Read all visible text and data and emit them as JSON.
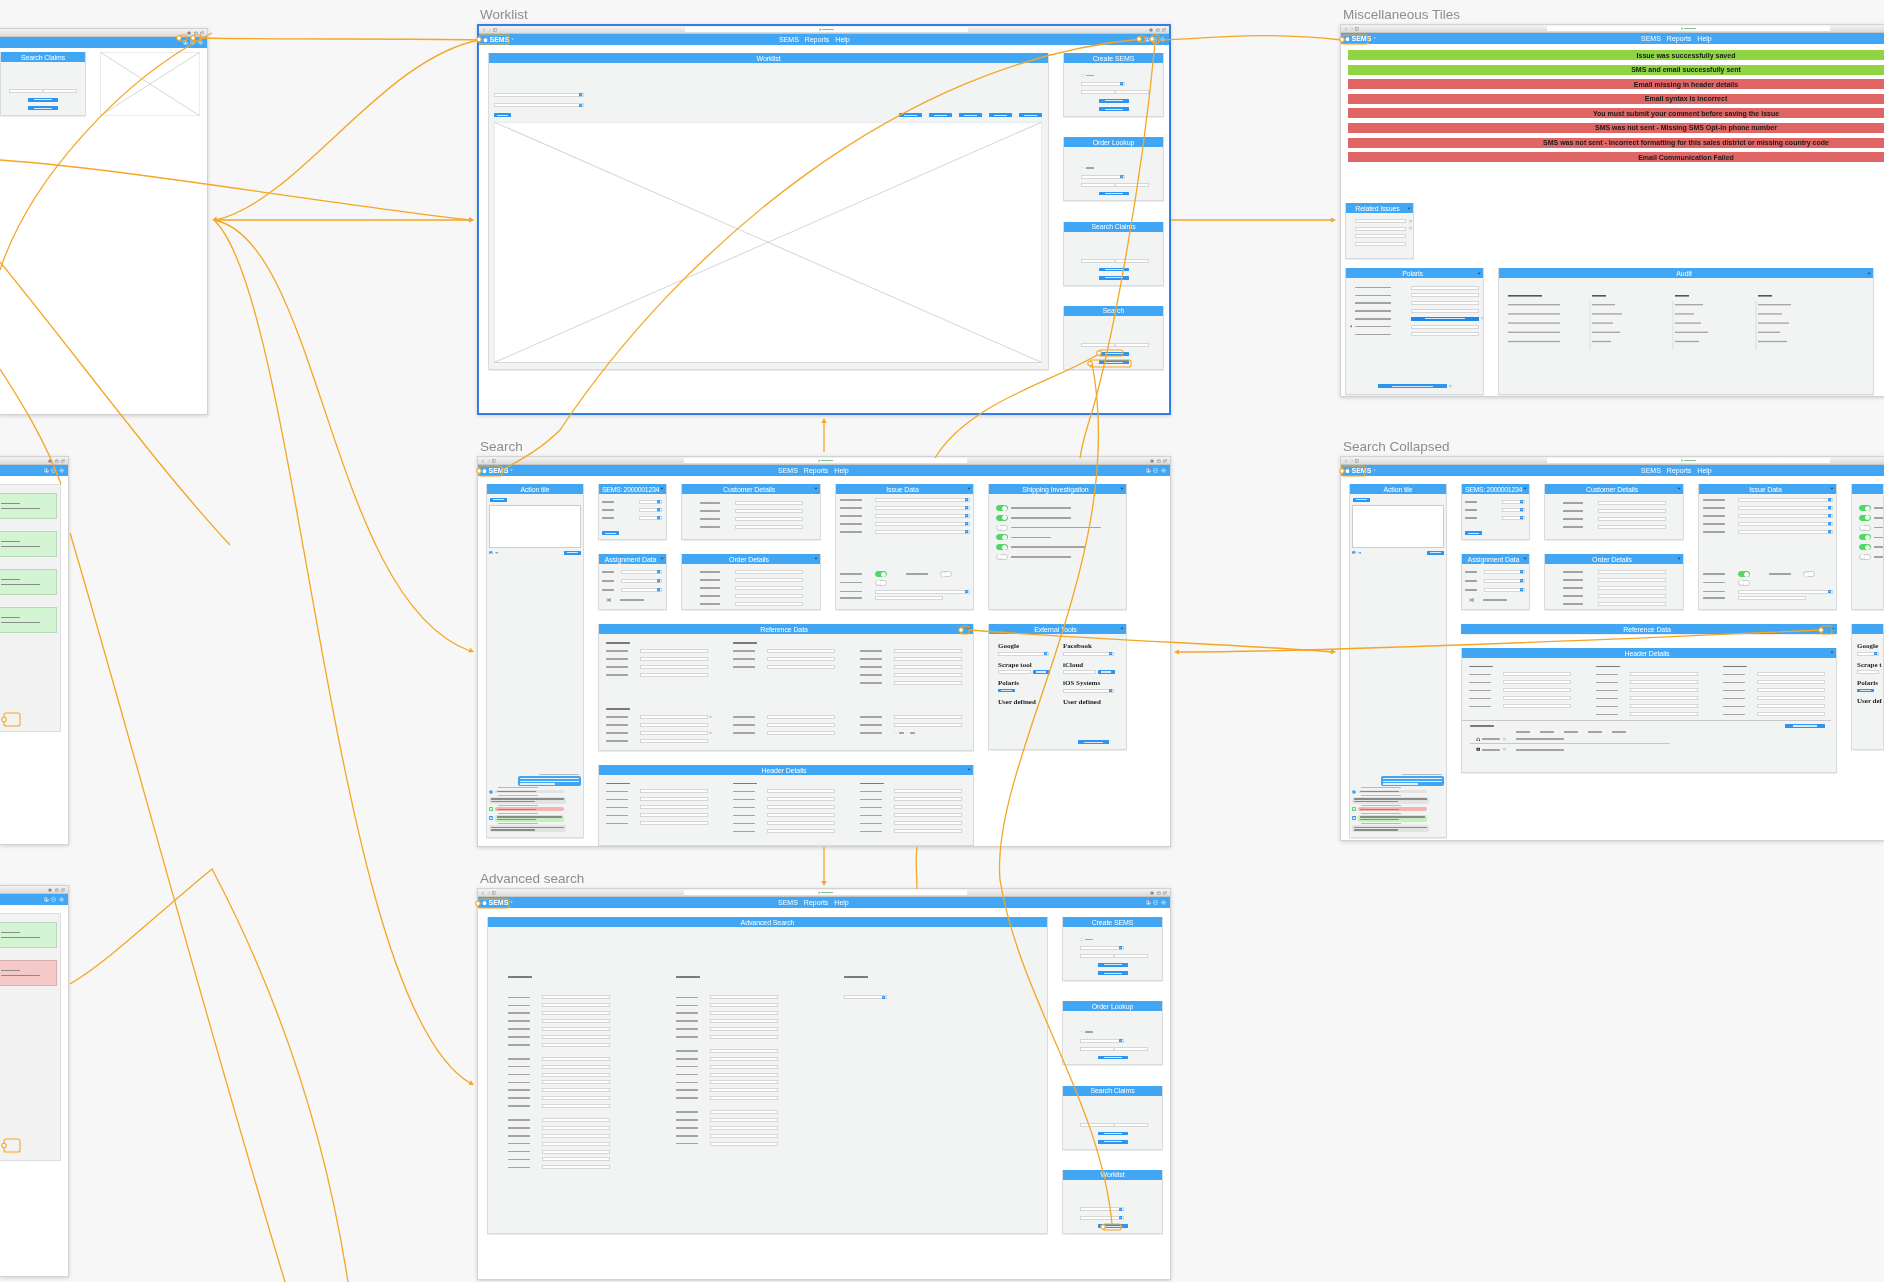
{
  "artboards": [
    {
      "kind": "claims",
      "selected": false,
      "tile": {
        "title": "Search Claims",
        "rows": [
          {
            "kind": "search"
          },
          {
            "kind": "button"
          },
          {
            "kind": "button"
          }
        ]
      }
    },
    {
      "kind": "worklist",
      "title": "Worklist",
      "selected": true,
      "nav": {
        "brand": "SEMS",
        "links": [
          "SEMS",
          "Reports",
          "Help"
        ]
      },
      "main": {
        "title": "Worklist",
        "filters": [
          {
            "kind": "select"
          },
          {
            "kind": "select"
          }
        ],
        "actions": [
          {
            "kind": "button"
          },
          {
            "kind": "button"
          },
          {
            "kind": "button"
          },
          {
            "kind": "button"
          },
          {
            "kind": "button"
          },
          {
            "kind": "button"
          }
        ]
      },
      "side": [
        {
          "title": "Create SEMS",
          "rows": [
            {
              "kind": "check",
              "checked": false
            },
            {
              "kind": "select"
            },
            {
              "kind": "search"
            },
            {
              "kind": "button"
            },
            {
              "kind": "button"
            }
          ]
        },
        {
          "title": "Order Lookup",
          "rows": [
            {
              "kind": "check",
              "checked": false
            },
            {
              "kind": "select"
            },
            {
              "kind": "search"
            },
            {
              "kind": "button"
            }
          ]
        },
        {
          "title": "Search Claims",
          "rows": [
            {
              "kind": "search"
            },
            {
              "kind": "button"
            },
            {
              "kind": "button"
            }
          ]
        },
        {
          "title": "Search",
          "rows": [
            {
              "kind": "search"
            },
            {
              "kind": "button"
            },
            {
              "kind": "button"
            }
          ]
        }
      ]
    },
    {
      "kind": "tiles",
      "title": "Miscellaneous Tiles",
      "selected": false,
      "nav": {
        "brand": "SEMS",
        "links": [
          "SEMS",
          "Reports",
          "Help"
        ]
      },
      "messages": [
        {
          "text": "Issue was successfully saved",
          "color": "#8ed443"
        },
        {
          "text": "SMS and email successfully sent",
          "color": "#8ed443"
        },
        {
          "text": "Email missing in header details",
          "color": "#e06666"
        },
        {
          "text": "Email syntax is incorrect",
          "color": "#e06666"
        },
        {
          "text": "You must submit your comment before saving the issue",
          "color": "#e06666"
        },
        {
          "text": "SMS was not sent - Missing SMS Opt-in phone number",
          "color": "#e06666"
        },
        {
          "text": "SMS was not sent - Incorrect formatting for this sales district or missing country code",
          "color": "#e06666"
        },
        {
          "text": "Email Communication Failed",
          "color": "#e06666"
        }
      ],
      "related": {
        "title": "Related issues",
        "expanded": true,
        "rows": [
          {
            "kind": "lookup"
          },
          {
            "kind": "lookup"
          },
          {
            "kind": "field"
          },
          {
            "kind": "field"
          }
        ]
      },
      "polaris": {
        "title": "Polaris",
        "expanded": true,
        "rows": [
          {
            "kind": "field",
            "alert": false
          },
          {
            "kind": "field",
            "alert": false
          },
          {
            "kind": "field",
            "alert": false
          },
          {
            "kind": "field",
            "alert": false
          },
          {
            "kind": "link",
            "alert": false
          },
          {
            "kind": "field",
            "alert": true
          },
          {
            "kind": "field",
            "alert": false
          }
        ]
      },
      "audit": {
        "title": "Audit",
        "expanded": true
      }
    },
    {
      "kind": "notifications",
      "selected": false,
      "cards": [
        {
          "color": "#d3f5d3"
        },
        {
          "color": "#d3f5d3"
        },
        {
          "color": "#d3f5d3"
        },
        {
          "color": "#d3f5d3"
        }
      ]
    },
    {
      "kind": "search",
      "title": "Search",
      "selected": false,
      "nav": {
        "brand": "SEMS",
        "links": [
          "SEMS",
          "Reports",
          "Help"
        ]
      },
      "action": {
        "title": "Action tile",
        "messages": [
          {
            "kind": "outgoing"
          },
          {
            "kind": "file"
          },
          {
            "kind": "note"
          },
          {
            "kind": "failed"
          },
          {
            "kind": "sent"
          },
          {
            "kind": "note"
          }
        ]
      },
      "sems": {
        "title": "SEMS: 2000001234",
        "expanded": true,
        "rows": [
          {
            "kind": "select"
          },
          {
            "kind": "select"
          },
          {
            "kind": "select"
          }
        ]
      },
      "customer": {
        "title": "Customer Details",
        "expanded": true,
        "rows": [
          {
            "kind": "field"
          },
          {
            "kind": "field"
          },
          {
            "kind": "field"
          },
          {
            "kind": "field"
          }
        ]
      },
      "issue": {
        "title": "Issue Data",
        "expanded": true,
        "rows": [
          {
            "kind": "select"
          },
          {
            "kind": "select"
          },
          {
            "kind": "select"
          },
          {
            "kind": "select"
          },
          {
            "kind": "select"
          }
        ],
        "flags": [
          {
            "on": true
          },
          {
            "on": false
          },
          {
            "on": false
          }
        ],
        "extra": [
          {
            "kind": "select"
          },
          {
            "kind": "field"
          }
        ]
      },
      "shipping": {
        "title": "Shipping Investigation",
        "expanded": true,
        "items": [
          {
            "on": true
          },
          {
            "on": true
          },
          {
            "on": false
          },
          {
            "on": true
          },
          {
            "on": true
          },
          {
            "on": false
          }
        ]
      },
      "assignment": {
        "title": "Assignment Data",
        "expanded": true,
        "rows": [
          {
            "kind": "select"
          },
          {
            "kind": "select"
          },
          {
            "kind": "select"
          }
        ]
      },
      "order": {
        "title": "Order Details",
        "expanded": true,
        "rows": [
          {
            "kind": "field"
          },
          {
            "kind": "field"
          },
          {
            "kind": "field"
          },
          {
            "kind": "field"
          },
          {
            "kind": "field"
          }
        ]
      },
      "reference": {
        "title": "Reference Data",
        "expanded": true,
        "blocks": [
          {
            "columns": [
              {
                "kind": "headed",
                "rows": [
                  {
                    "kind": "field"
                  },
                  {
                    "kind": "field"
                  },
                  {
                    "kind": "field"
                  },
                  {
                    "kind": "field"
                  }
                ]
              },
              {
                "kind": "headed",
                "rows": [
                  {
                    "kind": "field"
                  },
                  {
                    "kind": "field"
                  },
                  {
                    "kind": "field"
                  }
                ]
              },
              {
                "kind": "plain",
                "rows": [
                  {
                    "kind": "field"
                  },
                  {
                    "kind": "field"
                  },
                  {
                    "kind": "field"
                  },
                  {
                    "kind": "field"
                  },
                  {
                    "kind": "field"
                  }
                ]
              }
            ]
          },
          {
            "columns": [
              {
                "kind": "headed",
                "rows": [
                  {
                    "kind": "lookup"
                  },
                  {
                    "kind": "field"
                  },
                  {
                    "kind": "lookup"
                  },
                  {
                    "kind": "field"
                  }
                ]
              },
              {
                "kind": "plain",
                "rows": [
                  {
                    "kind": "field"
                  },
                  {
                    "kind": "field"
                  },
                  {
                    "kind": "field"
                  }
                ]
              },
              {
                "kind": "plain",
                "rows": [
                  {
                    "kind": "field"
                  },
                  {
                    "kind": "field"
                  },
                  {
                    "kind": "radio",
                    "options": [
                      {
                        "selected": false
                      },
                      {
                        "selected": false
                      }
                    ]
                  }
                ]
              }
            ]
          }
        ]
      },
      "tools": {
        "title": "External Tools",
        "expanded": true,
        "items": [
          {
            "name": "Google",
            "control": {
              "kind": "select"
            }
          },
          {
            "name": "Facebook",
            "control": {
              "kind": "select"
            }
          },
          {
            "name": "Scrape tool",
            "control": {
              "kind": "search"
            }
          },
          {
            "name": "iCloud",
            "control": {
              "kind": "search"
            }
          },
          {
            "name": "Polaris",
            "control": {
              "kind": "button"
            }
          },
          {
            "name": "iOS Systems",
            "control": {
              "kind": "select"
            }
          },
          {
            "name": "User defined"
          },
          {
            "name": "User defined"
          }
        ]
      },
      "header": {
        "title": "Header Details",
        "expanded": true,
        "blocks": [
          {
            "columns": [
              {
                "kind": "headed",
                "rows": [
                  {
                    "kind": "field"
                  },
                  {
                    "kind": "field"
                  },
                  {
                    "kind": "field"
                  },
                  {
                    "kind": "field"
                  },
                  {
                    "kind": "field"
                  }
                ]
              },
              {
                "kind": "headed",
                "rows": [
                  {
                    "kind": "field"
                  },
                  {
                    "kind": "field"
                  },
                  {
                    "kind": "field"
                  },
                  {
                    "kind": "field"
                  },
                  {
                    "kind": "field"
                  },
                  {
                    "kind": "field"
                  }
                ]
              },
              {
                "kind": "headed",
                "rows": [
                  {
                    "kind": "field"
                  },
                  {
                    "kind": "field"
                  },
                  {
                    "kind": "field"
                  },
                  {
                    "kind": "field"
                  },
                  {
                    "kind": "field"
                  },
                  {
                    "kind": "field"
                  }
                ]
              }
            ]
          }
        ]
      }
    },
    {
      "kind": "search",
      "title": "Search Collapsed",
      "selected": false,
      "nav": {
        "brand": "SEMS",
        "links": [
          "SEMS",
          "Reports",
          "Help"
        ]
      },
      "action": {
        "title": "Action tile",
        "messages": [
          {
            "kind": "outgoing"
          },
          {
            "kind": "file"
          },
          {
            "kind": "note"
          },
          {
            "kind": "failed"
          },
          {
            "kind": "sent"
          },
          {
            "kind": "note"
          }
        ]
      },
      "sems": {
        "title": "SEMS: 2000001234",
        "expanded": true,
        "rows": [
          {
            "kind": "select"
          },
          {
            "kind": "select"
          },
          {
            "kind": "select"
          }
        ]
      },
      "customer": {
        "title": "Customer Details",
        "expanded": true,
        "rows": [
          {
            "kind": "field"
          },
          {
            "kind": "field"
          },
          {
            "kind": "field"
          },
          {
            "kind": "field"
          }
        ]
      },
      "issue": {
        "title": "Issue Data",
        "expanded": true,
        "rows": [
          {
            "kind": "select"
          },
          {
            "kind": "select"
          },
          {
            "kind": "select"
          },
          {
            "kind": "select"
          },
          {
            "kind": "select"
          }
        ],
        "flags": [
          {
            "on": true
          },
          {
            "on": false
          },
          {
            "on": false
          }
        ],
        "extra": [
          {
            "kind": "select"
          },
          {
            "kind": "field"
          }
        ]
      },
      "shipping": {
        "items": [
          {
            "on": true
          },
          {
            "on": true
          },
          {
            "on": false
          },
          {
            "on": true
          },
          {
            "on": true
          },
          {
            "on": false
          }
        ]
      },
      "assignment": {
        "title": "Assignment Data",
        "expanded": true,
        "rows": [
          {
            "kind": "select"
          },
          {
            "kind": "select"
          },
          {
            "kind": "select"
          }
        ]
      },
      "order": {
        "title": "Order Details",
        "expanded": true,
        "rows": [
          {
            "kind": "field"
          },
          {
            "kind": "field"
          },
          {
            "kind": "field"
          },
          {
            "kind": "field"
          },
          {
            "kind": "field"
          }
        ]
      },
      "reference": {
        "title": "Reference Data",
        "expanded": false
      },
      "tools": {
        "items": [
          {
            "name": "Google",
            "control": {
              "kind": "select"
            }
          },
          {
            "name": "Scrape t",
            "control": {
              "kind": "input"
            }
          },
          {
            "name": "Polaris",
            "control": {
              "kind": "button"
            }
          },
          {
            "name": "User def"
          }
        ]
      },
      "header": {
        "title": "Header Details",
        "expanded": true,
        "blocks": [
          {
            "columns": [
              {
                "kind": "headed",
                "rows": [
                  {
                    "kind": "field"
                  },
                  {
                    "kind": "field"
                  },
                  {
                    "kind": "field"
                  },
                  {
                    "kind": "field"
                  },
                  {
                    "kind": "field"
                  }
                ]
              },
              {
                "kind": "headed",
                "rows": [
                  {
                    "kind": "field"
                  },
                  {
                    "kind": "field"
                  },
                  {
                    "kind": "field"
                  },
                  {
                    "kind": "field"
                  },
                  {
                    "kind": "field"
                  },
                  {
                    "kind": "field"
                  }
                ]
              },
              {
                "kind": "headed",
                "rows": [
                  {
                    "kind": "field"
                  },
                  {
                    "kind": "field"
                  },
                  {
                    "kind": "field"
                  },
                  {
                    "kind": "field"
                  },
                  {
                    "kind": "field"
                  },
                  {
                    "kind": "field"
                  }
                ]
              }
            ]
          }
        ],
        "order": {
          "items": [
            {
              "kind": "headphones"
            },
            {
              "kind": "device"
            }
          ]
        }
      }
    },
    {
      "kind": "notifications",
      "selected": false,
      "cards": [
        {
          "color": "#d3f5d3"
        },
        {
          "color": "#f5c9c9"
        }
      ]
    },
    {
      "kind": "advanced",
      "title": "Advanced search",
      "selected": false,
      "nav": {
        "brand": "SEMS",
        "links": [
          "SEMS",
          "Reports",
          "Help"
        ]
      },
      "main": {
        "title": "Advanced Search",
        "columns": [
          {
            "kind": "fields",
            "groups": [
              [
                {
                  "kind": "field"
                },
                {
                  "kind": "field"
                },
                {
                  "kind": "field"
                },
                {
                  "kind": "field"
                },
                {
                  "kind": "field"
                },
                {
                  "kind": "field"
                },
                {
                  "kind": "field"
                }
              ],
              [
                {
                  "kind": "field"
                },
                {
                  "kind": "field"
                },
                {
                  "kind": "field"
                },
                {
                  "kind": "field"
                },
                {
                  "kind": "field"
                },
                {
                  "kind": "field"
                },
                {
                  "kind": "field"
                }
              ],
              [
                {
                  "kind": "field"
                },
                {
                  "kind": "field"
                },
                {
                  "kind": "field"
                },
                {
                  "kind": "field"
                },
                {
                  "kind": "field"
                },
                {
                  "kind": "field"
                },
                {
                  "kind": "field"
                }
              ]
            ]
          },
          {
            "kind": "fields",
            "groups": [
              [
                {
                  "kind": "field"
                },
                {
                  "kind": "field"
                },
                {
                  "kind": "field"
                },
                {
                  "kind": "field"
                },
                {
                  "kind": "field"
                },
                {
                  "kind": "field"
                }
              ],
              [
                {
                  "kind": "field"
                },
                {
                  "kind": "field"
                },
                {
                  "kind": "field"
                },
                {
                  "kind": "field"
                },
                {
                  "kind": "field"
                },
                {
                  "kind": "field"
                },
                {
                  "kind": "field"
                }
              ],
              [
                {
                  "kind": "field"
                },
                {
                  "kind": "field"
                },
                {
                  "kind": "field"
                },
                {
                  "kind": "field"
                },
                {
                  "kind": "field"
                }
              ]
            ]
          },
          {
            "kind": "select"
          }
        ]
      },
      "side": [
        {
          "title": "Create SEMS",
          "rows": [
            {
              "kind": "check",
              "checked": false
            },
            {
              "kind": "select"
            },
            {
              "kind": "search"
            },
            {
              "kind": "button"
            },
            {
              "kind": "button"
            }
          ]
        },
        {
          "title": "Order Lookup",
          "rows": [
            {
              "kind": "check",
              "checked": false
            },
            {
              "kind": "select"
            },
            {
              "kind": "search"
            },
            {
              "kind": "button"
            }
          ]
        },
        {
          "title": "Search Claims",
          "rows": [
            {
              "kind": "search"
            },
            {
              "kind": "button"
            },
            {
              "kind": "button"
            }
          ]
        },
        {
          "title": "Worklist",
          "rows": [
            {
              "kind": "select"
            },
            {
              "kind": "select"
            },
            {
              "kind": "button"
            }
          ]
        }
      ]
    }
  ]
}
